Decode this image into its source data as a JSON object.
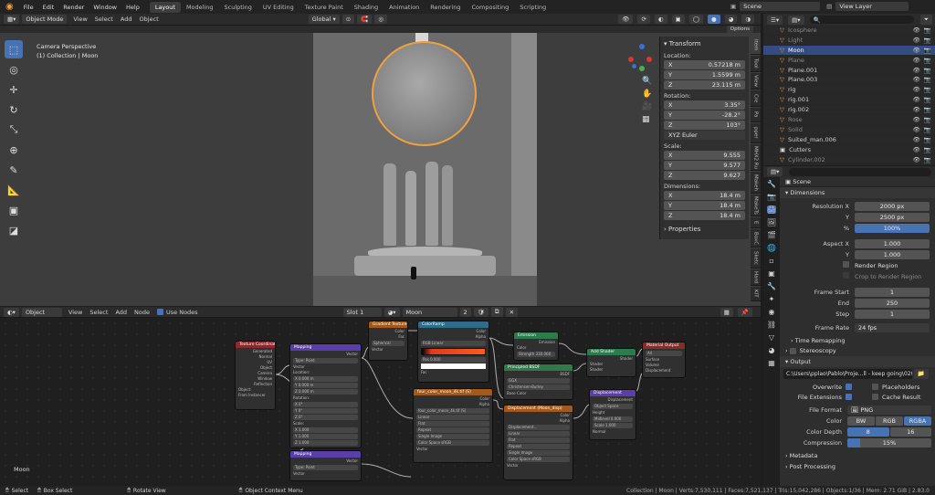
{
  "menu": [
    "File",
    "Edit",
    "Render",
    "Window",
    "Help"
  ],
  "workspaces": [
    "Layout",
    "Modeling",
    "Sculpting",
    "UV Editing",
    "Texture Paint",
    "Shading",
    "Animation",
    "Rendering",
    "Compositing",
    "Scripting"
  ],
  "scene_name": "Scene",
  "view_layer": "View Layer",
  "viewport": {
    "mode": "Object Mode",
    "menus": [
      "View",
      "Select",
      "Add",
      "Object"
    ],
    "orientation": "Global",
    "options_label": "Options",
    "camera_label": "Camera Perspective",
    "collection_label": "(1) Collection | Moon",
    "object_name": "Moon"
  },
  "npanel": {
    "title": "Transform",
    "location_label": "Location:",
    "location": [
      "0.57218 m",
      "1.5599 m",
      "23.115 m"
    ],
    "rotation_label": "Rotation:",
    "rotation": [
      "3.35°",
      "-28.2°",
      "103°"
    ],
    "rotation_mode": "XYZ Euler",
    "scale_label": "Scale:",
    "scale": [
      "9.555",
      "9.577",
      "9.627"
    ],
    "dimensions_label": "Dimensions:",
    "dimensions": [
      "18.4 m",
      "18.4 m",
      "18.4 m"
    ],
    "properties_label": "Properties",
    "axes": [
      "X",
      "Y",
      "Z"
    ],
    "tabs": [
      "Item",
      "Tool",
      "View",
      "Cre",
      "Pa",
      "pper",
      "MHX2 Ru",
      "Makeh",
      "MakeTs",
      "E",
      "BoxC",
      "Sketc",
      "Hard",
      "KIT"
    ]
  },
  "outliner": {
    "items": [
      {
        "name": "Icosphere",
        "dim": true
      },
      {
        "name": "Light",
        "dim": true
      },
      {
        "name": "Moon",
        "selected": true
      },
      {
        "name": "Plane",
        "dim": true
      },
      {
        "name": "Plane.001"
      },
      {
        "name": "Plane.003"
      },
      {
        "name": "rig"
      },
      {
        "name": "rig.001"
      },
      {
        "name": "rig.002"
      },
      {
        "name": "Rose",
        "dim": true
      },
      {
        "name": "Solid",
        "dim": true
      },
      {
        "name": "Suited_man.006"
      },
      {
        "name": "Cutters"
      },
      {
        "name": "Cylinder.002",
        "dim": true
      }
    ]
  },
  "properties": {
    "scene": "Scene",
    "dimensions_title": "Dimensions",
    "res_x_label": "Resolution X",
    "res_x": "2000 px",
    "res_y_label": "Y",
    "res_y": "2500 px",
    "res_pct_label": "%",
    "res_pct": "100%",
    "aspect_x_label": "Aspect X",
    "aspect_x": "1.000",
    "aspect_y_label": "Y",
    "aspect_y": "1.000",
    "render_region": "Render Region",
    "crop_region": "Crop to Render Region",
    "frame_start_label": "Frame Start",
    "frame_start": "1",
    "end_label": "End",
    "end": "250",
    "step_label": "Step",
    "step": "1",
    "frame_rate_label": "Frame Rate",
    "frame_rate": "24 fps",
    "time_remap": "Time Remapping",
    "stereoscopy": "Stereoscopy",
    "output_title": "Output",
    "output_path": "C:\\Users\\pplao\\Pablo\\Proje...ll - keep going\\0207\\0207",
    "overwrite": "Overwrite",
    "placeholders": "Placeholders",
    "file_ext": "File Extensions",
    "cache_result": "Cache Result",
    "file_format_label": "File Format",
    "file_format": "PNG",
    "color_label": "Color",
    "color_opts": [
      "BW",
      "RGB",
      "RGBA"
    ],
    "color_depth_label": "Color Depth",
    "color_depth": [
      "8",
      "16"
    ],
    "compression_label": "Compression",
    "compression": "15%",
    "compression_value": 0.15,
    "metadata": "Metadata",
    "post_processing": "Post Processing"
  },
  "node_editor": {
    "editor_type": "Object",
    "menus": [
      "View",
      "Select",
      "Add",
      "Node"
    ],
    "use_nodes": "Use Nodes",
    "slot": "Slot 1",
    "material": "Moon",
    "users": "2",
    "object_label": "Moon"
  },
  "nodes": [
    {
      "title": "Texture Coordinate",
      "color": "#8b2a2a",
      "rows": [
        "Generated",
        "Normal",
        "UV",
        "Object",
        "Camera",
        "Window",
        "Reflection",
        "Object:",
        "From Instancer"
      ]
    },
    {
      "title": "Mapping",
      "color": "#5b3fa8",
      "rows": [
        "Vector",
        "Type: Point",
        "Vector",
        "Location:",
        "X 0.000 m",
        "Y 0.000 m",
        "Z 0.000 m",
        "Rotation:",
        "X 0°",
        "Y 0°",
        "Z 0°",
        "Scale:",
        "X 1.000",
        "Y 1.000",
        "Z 1.000"
      ]
    },
    {
      "title": "Mapping",
      "color": "#5b3fa8",
      "rows": [
        "Vector",
        "Type: Point",
        "Vector"
      ]
    },
    {
      "title": "Gradient Texture",
      "color": "#a05a1e",
      "rows": [
        "Color",
        "Fac",
        "Spherical",
        "Vector"
      ]
    },
    {
      "title": "ColorRamp",
      "color": "#2f6b8a",
      "rows": [
        "Color",
        "Alpha",
        "RGB   Linear",
        "Pos 0.000",
        "Fac"
      ]
    },
    {
      "title": "four_color_moon_4k.tif (S)",
      "color": "#a05a1e",
      "rows": [
        "Color",
        "Alpha",
        "four_color_moon_4k.tif (S)",
        "Linear",
        "Flat",
        "Repeat",
        "Single Image",
        "Color Space  sRGB",
        "Vector"
      ]
    },
    {
      "title": "Emission",
      "color": "#2f7a4a",
      "rows": [
        "Emission",
        "Color",
        "Strength 330.000"
      ]
    },
    {
      "title": "Principled BSDF",
      "color": "#2f7a4a",
      "rows": [
        "BSDF",
        "GGX",
        "Christensen-Burley",
        "Base Color"
      ]
    },
    {
      "title": "Displacement (Moon_disp)",
      "color": "#a05a1e",
      "rows": [
        "Color",
        "Alpha",
        "Displacement...",
        "Linear",
        "Flat",
        "Repeat",
        "Single Image",
        "Color Space  sRGB",
        "Vector"
      ]
    },
    {
      "title": "Add Shader",
      "color": "#2f7a4a",
      "rows": [
        "Shader",
        "Shader",
        "Shader"
      ]
    },
    {
      "title": "Displacement",
      "color": "#5b3fa8",
      "rows": [
        "Displacement",
        "Object Space",
        "Height",
        "Midlevel 0.000",
        "Scale 1.000",
        "Normal"
      ]
    },
    {
      "title": "Material Output",
      "color": "#8b2a2a",
      "rows": [
        "All",
        "Surface",
        "Volume",
        "Displacement"
      ]
    }
  ],
  "status": {
    "select": "Select",
    "box_select": "Box Select",
    "rotate": "Rotate View",
    "context": "Object Context Menu",
    "stats": "Collection | Moon | Verts:7,530,111 | Faces:7,521,137 | Tris:15,042,286 | Objects:1/36 | Mem: 2.71 GiB | 2.83.0"
  },
  "colors": {
    "accent": "#4772b3",
    "selection": "#334d80",
    "orange": "#f0a040"
  }
}
